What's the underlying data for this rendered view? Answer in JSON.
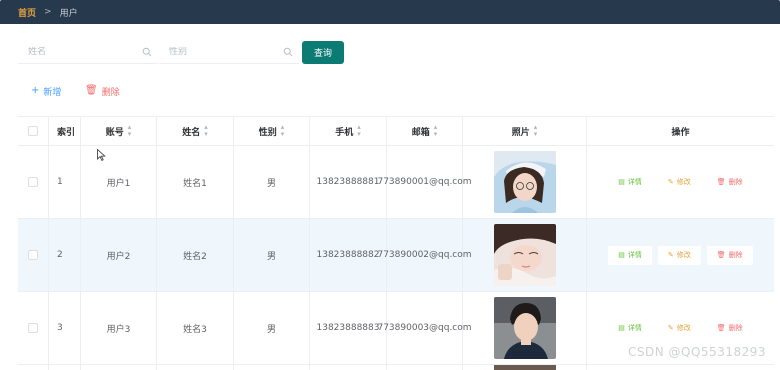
{
  "breadcrumb": {
    "home": "首页",
    "separator": ">",
    "current": "用户"
  },
  "search": {
    "name_placeholder": "姓名",
    "gender_placeholder": "性别",
    "query_label": "查询"
  },
  "toolbar": {
    "add_label": "新增",
    "delete_label": "删除"
  },
  "table": {
    "headers": {
      "index": "索引",
      "account": "账号",
      "name": "姓名",
      "gender": "性别",
      "phone": "手机",
      "email": "邮箱",
      "photo": "照片",
      "actions": "操作"
    },
    "rows": [
      {
        "index": "1",
        "account": "用户1",
        "name": "姓名1",
        "gender": "男",
        "phone": "13823888881",
        "email": "773890001@qq.com"
      },
      {
        "index": "2",
        "account": "用户2",
        "name": "姓名2",
        "gender": "男",
        "phone": "13823888882",
        "email": "773890002@qq.com"
      },
      {
        "index": "3",
        "account": "用户3",
        "name": "姓名3",
        "gender": "男",
        "phone": "13823888883",
        "email": "773890003@qq.com"
      }
    ],
    "row_actions": {
      "view": "详情",
      "edit": "修改",
      "delete": "删除"
    }
  },
  "watermark": "CSDN @QQ55318293",
  "colors": {
    "topbar": "#26394d",
    "accent": "#0c7b74",
    "add": "#409eff",
    "delete": "#f56c6c",
    "view": "#67c23a",
    "edit": "#e6a23c"
  }
}
